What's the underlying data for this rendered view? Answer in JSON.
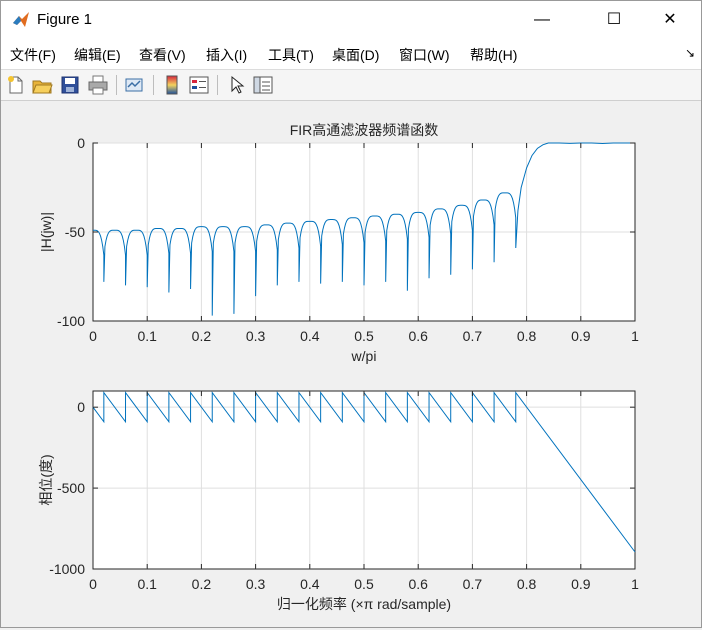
{
  "window": {
    "title": "Figure 1",
    "controls": {
      "minimize": "—",
      "maximize": "☐",
      "close": "✕"
    }
  },
  "menu": {
    "items": [
      "文件(F)",
      "编辑(E)",
      "查看(V)",
      "插入(I)",
      "工具(T)",
      "桌面(D)",
      "窗口(W)",
      "帮助(H)"
    ],
    "overflow_icon": "↘"
  },
  "toolbar": {
    "icons": [
      "new-figure-icon",
      "open-file-icon",
      "save-icon",
      "print-icon",
      "link-plot-icon",
      "insert-colorbar-icon",
      "insert-legend-icon",
      "pointer-icon",
      "property-inspector-icon"
    ]
  },
  "colors": {
    "line": "#0072bd",
    "grid": "#dfdfdf",
    "axes_bg": "#ffffff",
    "figure_bg": "#f0f0f0"
  },
  "chart_data": [
    {
      "type": "line",
      "title": "FIR高通滤波器频谱函数",
      "xlabel": "w/pi",
      "ylabel": "|H(jw)|",
      "xlim": [
        0,
        1
      ],
      "ylim": [
        -100,
        0
      ],
      "xticks": [
        "0",
        "0.1",
        "0.2",
        "0.3",
        "0.4",
        "0.5",
        "0.6",
        "0.7",
        "0.8",
        "0.9",
        "1"
      ],
      "yticks": [
        "-100",
        "-50",
        "0"
      ],
      "grid": true,
      "passband_edge": 0.8,
      "stopband_nulls": [
        0.02,
        0.06,
        0.1,
        0.14,
        0.18,
        0.22,
        0.26,
        0.3,
        0.34,
        0.38,
        0.42,
        0.46,
        0.5,
        0.54,
        0.58,
        0.62,
        0.66,
        0.7,
        0.74,
        0.78
      ],
      "null_depths": [
        -78,
        -80,
        -81,
        -84,
        -82,
        -97,
        -96,
        -86,
        -80,
        -78,
        -79,
        -78,
        -80,
        -78,
        -83,
        -76,
        -74,
        -71,
        -67,
        -59
      ],
      "lobe_peaks": [
        -49,
        -49,
        -49,
        -48,
        -48,
        -47,
        -47,
        -47,
        -46,
        -45,
        -44,
        -43,
        -42,
        -41,
        -40,
        -39,
        -37,
        -35,
        -32,
        -28,
        -25
      ],
      "transition": [
        [
          0.78,
          -59
        ],
        [
          0.784,
          -38
        ],
        [
          0.79,
          -25
        ],
        [
          0.8,
          -14
        ],
        [
          0.81,
          -7
        ],
        [
          0.82,
          -3
        ],
        [
          0.83,
          -1
        ],
        [
          0.84,
          0
        ]
      ],
      "passband": [
        [
          0.84,
          0
        ],
        [
          0.86,
          0
        ],
        [
          0.88,
          -0.2
        ],
        [
          0.9,
          0
        ],
        [
          0.92,
          0.2
        ],
        [
          0.94,
          -0.3
        ],
        [
          0.96,
          0
        ],
        [
          0.98,
          0
        ],
        [
          1.0,
          0
        ]
      ]
    },
    {
      "type": "line",
      "xlabel": "归一化频率 (×π rad/sample)",
      "ylabel": "相位(度)",
      "xlim": [
        0,
        1
      ],
      "ylim": [
        -1000,
        100
      ],
      "xticks": [
        "0",
        "0.1",
        "0.2",
        "0.3",
        "0.4",
        "0.5",
        "0.6",
        "0.7",
        "0.8",
        "0.9",
        "1"
      ],
      "yticks": [
        "-1000",
        "-500",
        "0"
      ],
      "grid": true,
      "sawtooth_jumps": [
        0.02,
        0.06,
        0.1,
        0.14,
        0.18,
        0.22,
        0.26,
        0.3,
        0.34,
        0.38,
        0.42,
        0.46,
        0.5,
        0.54,
        0.58,
        0.62,
        0.66,
        0.7,
        0.74,
        0.78
      ],
      "sawtooth_high": 90,
      "sawtooth_low": -90,
      "start": [
        0,
        0
      ],
      "linear_end": [
        1.0,
        -895
      ]
    }
  ]
}
